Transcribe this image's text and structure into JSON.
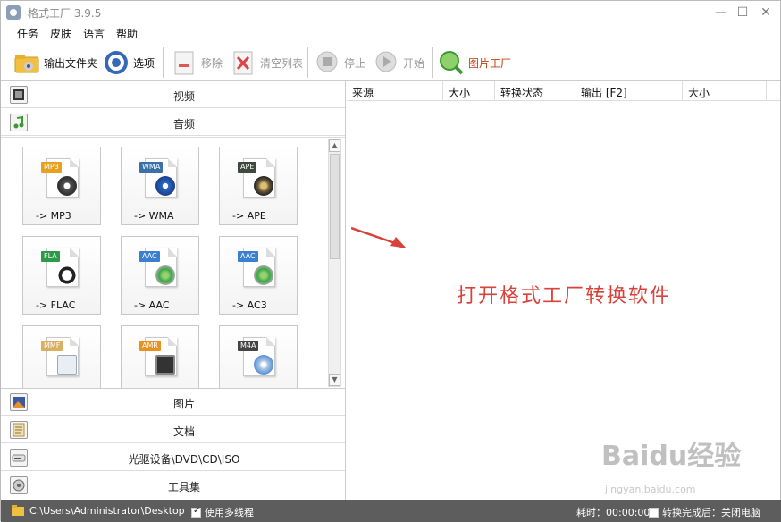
{
  "window": {
    "title": "格式工厂 3.9.5",
    "minimize": "—",
    "maximize": "☐",
    "close": "✕"
  },
  "menu": [
    "任务",
    "皮肤",
    "语言",
    "帮助"
  ],
  "toolbar": {
    "output_folder": "输出文件夹",
    "options": "选项",
    "remove": "移除",
    "clear_list": "清空列表",
    "stop": "停止",
    "start": "开始",
    "picture_factory": "图片工厂"
  },
  "categories": {
    "video": "视频",
    "audio": "音频",
    "picture": "图片",
    "document": "文档",
    "rom": "光驱设备\\DVD\\CD\\ISO",
    "tools": "工具集"
  },
  "audio_tiles": [
    {
      "badge": "MP3",
      "label": "-> MP3",
      "badge_color": "#e8a020",
      "glyph_color": "#555"
    },
    {
      "badge": "WMA",
      "label": "-> WMA",
      "badge_color": "#3a6fa8",
      "glyph_color": "#2a66c8"
    },
    {
      "badge": "APE",
      "label": "-> APE",
      "badge_color": "#3d4a3d",
      "glyph_color": "#6a5a3a"
    },
    {
      "badge": "FLA",
      "label": "-> FLAC",
      "badge_color": "#2d9a4a",
      "glyph_color": "#222"
    },
    {
      "badge": "AAC",
      "label": "-> AAC",
      "badge_color": "#3a7fd0",
      "glyph_color": "#3aa845"
    },
    {
      "badge": "AAC",
      "label": "-> AC3",
      "badge_color": "#3a7fd0",
      "glyph_color": "#3aa845"
    },
    {
      "badge": "MMF",
      "label": "",
      "badge_color": "#d8b060",
      "glyph_color": "#9ab"
    },
    {
      "badge": "AMR",
      "label": "",
      "badge_color": "#e89020",
      "glyph_color": "#333"
    },
    {
      "badge": "M4A",
      "label": "",
      "badge_color": "#444",
      "glyph_color": "#5a8fd0"
    }
  ],
  "task_table": {
    "columns": [
      "来源",
      "大小",
      "转换状态",
      "输出 [F2]",
      "大小"
    ]
  },
  "overlay": "打开格式工厂转换软件",
  "watermark": {
    "brand": "Baidu经验",
    "url": "jingyan.baidu.com"
  },
  "statusbar": {
    "path": "C:\\Users\\Administrator\\Desktop",
    "multithread": "使用多线程",
    "elapsed": "耗时：00:00:00",
    "shutdown": "转换完成后：关闭电脑"
  },
  "colors": {
    "accent_red": "#d9423a",
    "status_bg": "#5d5d5d"
  }
}
